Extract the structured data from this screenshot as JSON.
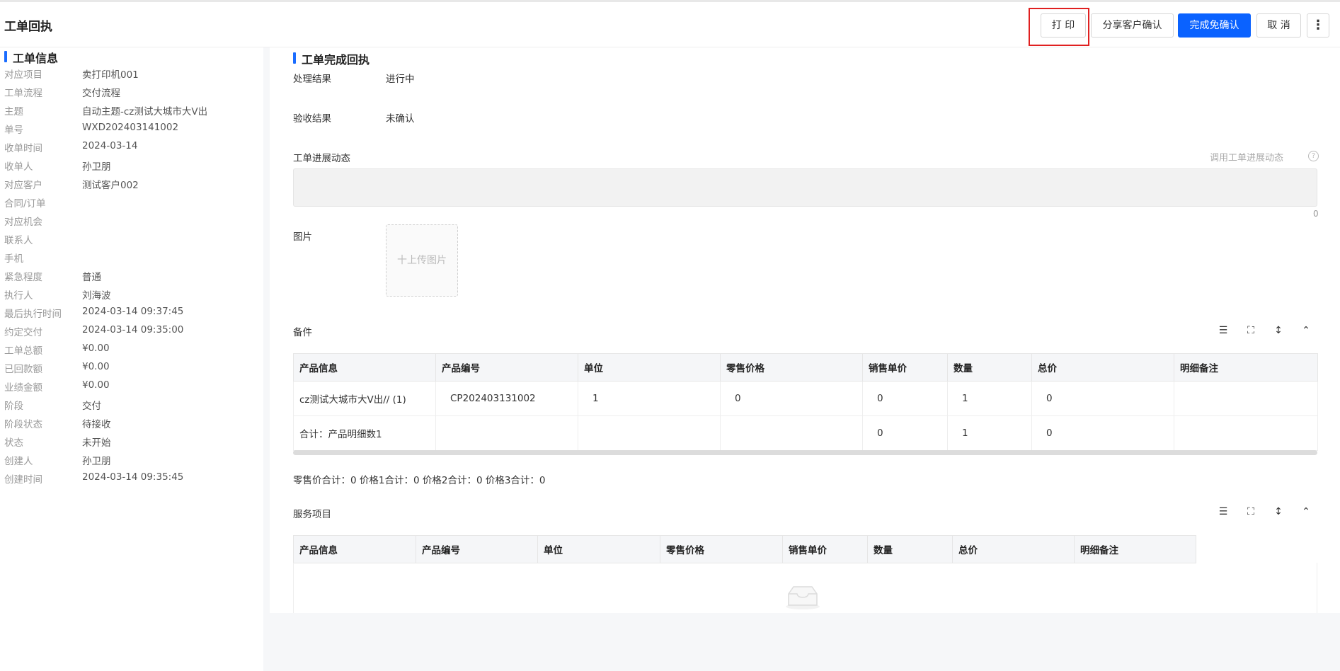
{
  "header": {
    "title": "工单回执",
    "buttons": {
      "print": "打 印",
      "share": "分享客户确认",
      "complete": "完成免确认",
      "cancel": "取 消",
      "more": "⋮"
    }
  },
  "left": {
    "section_title": "工单信息",
    "rows": [
      {
        "label": "对应项目",
        "value": "卖打印机001"
      },
      {
        "label": "工单流程",
        "value": "交付流程"
      },
      {
        "label": "主题",
        "value": "自动主题-cz测试大城市大V出"
      },
      {
        "label": "单号",
        "value": "WXD202403141002"
      },
      {
        "label": "收单时间",
        "value": "2024-03-14"
      },
      {
        "label": "收单人",
        "value": "孙卫朋"
      },
      {
        "label": "对应客户",
        "value": "测试客户002"
      },
      {
        "label": "合同/订单",
        "value": ""
      },
      {
        "label": "对应机会",
        "value": ""
      },
      {
        "label": "联系人",
        "value": ""
      },
      {
        "label": "手机",
        "value": ""
      },
      {
        "label": "紧急程度",
        "value": "普通"
      },
      {
        "label": "执行人",
        "value": "刘海波"
      },
      {
        "label": "最后执行时间",
        "value": "2024-03-14 09:37:45"
      },
      {
        "label": "约定交付",
        "value": "2024-03-14 09:35:00"
      },
      {
        "label": "工单总额",
        "value": "¥0.00"
      },
      {
        "label": "已回款额",
        "value": "¥0.00"
      },
      {
        "label": "业绩金额",
        "value": "¥0.00"
      },
      {
        "label": "阶段",
        "value": "交付"
      },
      {
        "label": "阶段状态",
        "value": "待接收"
      },
      {
        "label": "状态",
        "value": "未开始"
      },
      {
        "label": "创建人",
        "value": "孙卫朋"
      },
      {
        "label": "创建时间",
        "value": "2024-03-14 09:35:45"
      }
    ]
  },
  "main": {
    "section_title": "工单完成回执",
    "result_label": "处理结果",
    "result_value": "进行中",
    "accept_label": "验收结果",
    "accept_value": "未确认",
    "progress_label": "工单进展动态",
    "progress_link": "调用工单进展动态",
    "help": "?",
    "char_count": "0",
    "image_label": "图片",
    "upload_text": "十上传图片",
    "parts": {
      "title": "备件",
      "headers": [
        "产品信息",
        "产品编号",
        "单位",
        "零售价格",
        "销售单价",
        "数量",
        "总价",
        "明细备注"
      ],
      "row": [
        "cz测试大城市大V出// (1)",
        "CP202403131002",
        "1",
        "0",
        "0",
        "1",
        "0",
        ""
      ],
      "total_row": [
        "合计：产品明细数1",
        "",
        "",
        "",
        "0",
        "1",
        "0",
        ""
      ]
    },
    "summary": "零售价合计：0  价格1合计：0  价格2合计：0  价格3合计：0",
    "services": {
      "title": "服务项目",
      "headers": [
        "产品信息",
        "产品编号",
        "单位",
        "零售价格",
        "销售单价",
        "数量",
        "总价",
        "明细备注"
      ]
    },
    "colors": {
      "accent": "#0a62ff",
      "highlight": "#e02020"
    }
  }
}
